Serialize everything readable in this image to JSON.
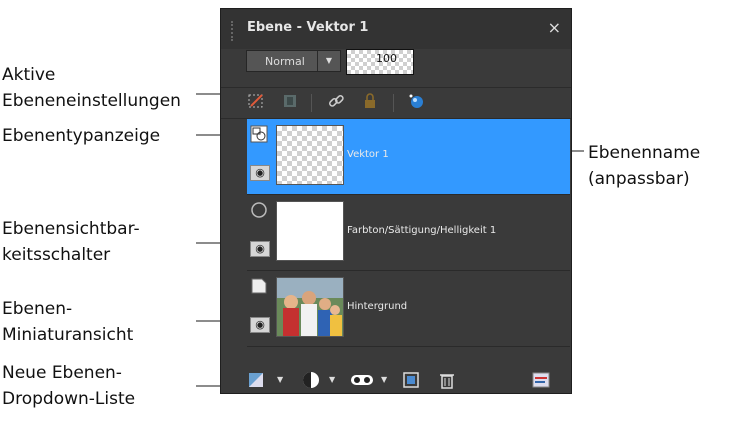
{
  "callouts": {
    "aktive": "Aktive\nEbeneneinstellungen",
    "ebenentyp": "Ebenentypanzeige",
    "ebenenname": "Ebenenname\n(anpassbar)",
    "sichtbarkeit": "Ebenensichtbar-\nkeitsschalter",
    "miniatur": "Ebenen-\nMiniaturansicht",
    "neue": "Neue Ebenen-\nDropdown-Liste"
  },
  "panel": {
    "title": "Ebene - Vektor 1",
    "close_label": "×",
    "blend_mode": "Normal",
    "opacity": "100"
  },
  "layers": [
    {
      "name": "Vektor 1",
      "type_icon": "vector-layer-icon",
      "selected": true
    },
    {
      "name": "Farbton/Sättigung/Helligkeit 1",
      "type_icon": "adjustment-layer-icon",
      "selected": false
    },
    {
      "name": "Hintergrund",
      "type_icon": "raster-layer-icon",
      "selected": false
    }
  ],
  "toolbar_icons": [
    "edit-layer-icon",
    "mask-icon",
    "link-icon",
    "lock-icon",
    "layer-effects-icon"
  ],
  "bottom_icons": [
    "new-raster-layer-icon",
    "new-adjustment-layer-icon",
    "new-mask-icon",
    "merge-icon",
    "delete-icon",
    "layer-properties-icon"
  ],
  "colors": {
    "selected_layer": "#3399ff",
    "panel_bg": "#3a3a3a"
  }
}
